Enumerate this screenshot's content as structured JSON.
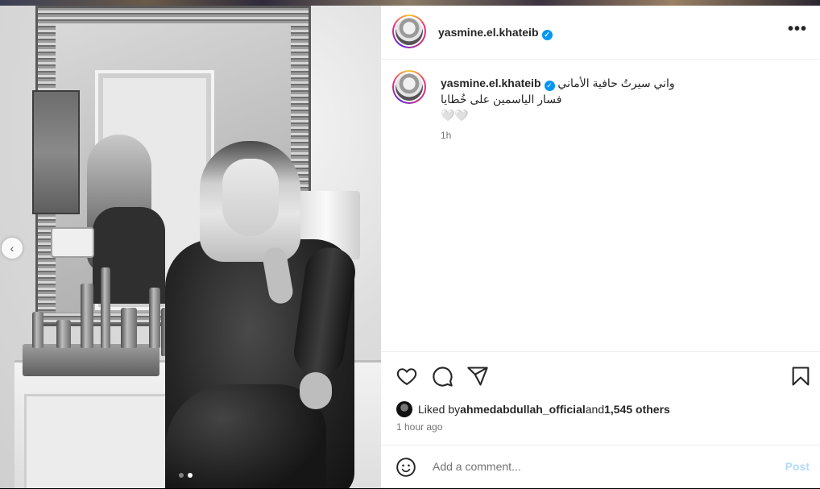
{
  "post": {
    "username": "yasmine.el.khateib",
    "caption_line1": "واني سيرتُ حافية الأماني",
    "caption_line2": "فسار الياسمين على خُطايا",
    "caption_line3": "🤍🤍",
    "caption_time": "1h",
    "more_label": "•••"
  },
  "carousel": {
    "prev_label": "‹",
    "total": 2,
    "active_index": 2
  },
  "actions": {
    "like_icon": "heart-icon",
    "comment_icon": "comment-icon",
    "share_icon": "share-icon",
    "save_icon": "bookmark-icon"
  },
  "likes": {
    "prefix": "Liked by ",
    "liker": "ahmedabdullah_official",
    "and_text": " and ",
    "others": "1,545 others"
  },
  "post_time": "1 hour ago",
  "comment": {
    "placeholder": "Add a comment...",
    "post_label": "Post"
  },
  "colors": {
    "verified": "#0095f6",
    "post_button_disabled": "#b3dbff",
    "secondary_text": "#737373"
  }
}
